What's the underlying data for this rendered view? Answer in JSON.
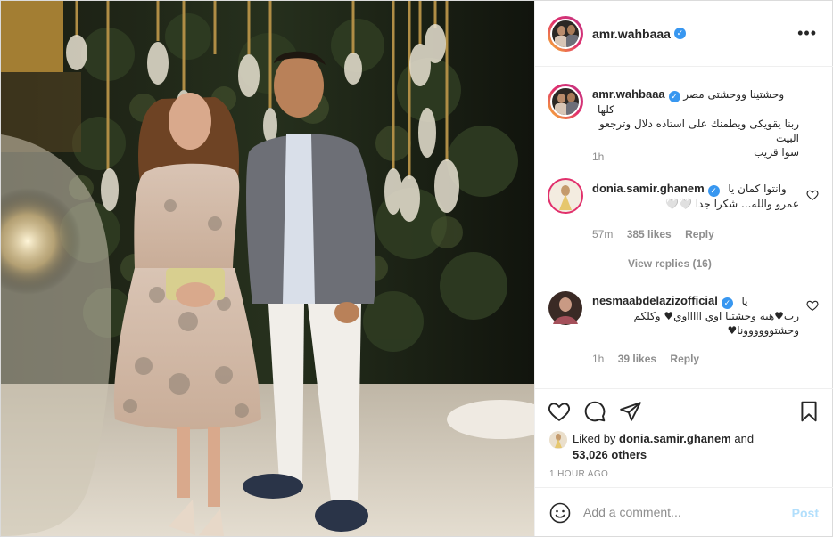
{
  "post": {
    "username": "amr.wahbaaa",
    "verified_mark": "✓",
    "more_icon": "more-horizontal-icon"
  },
  "caption": {
    "username": "amr.wahbaaa",
    "lines": [
      "وحشتينا ووحشتى مصر كلها",
      "ربنا يقويكى ويطمنك على استاذه دلال وترجعو البيت",
      "سوا قريب"
    ],
    "time": "1h"
  },
  "comments": [
    {
      "username": "donia.samir.ghanem",
      "lines": [
        "وانتوا كمان يا",
        "عمرو والله... شكرا جدا 🤍🤍"
      ],
      "time": "57m",
      "likes": "385 likes",
      "reply": "Reply",
      "view_replies": "View replies (16)"
    },
    {
      "username": "nesmaabdelazizofficial",
      "lines": [
        "يا",
        "رب♥هيه وحشتنا اوي اااااوي♥ وكلكم",
        "وحشتوووووونا♥"
      ],
      "time": "1h",
      "likes": "39 likes",
      "reply": "Reply"
    }
  ],
  "actions": {
    "like_icon": "heart-icon",
    "comment_icon": "comment-icon",
    "share_icon": "share-icon",
    "save_icon": "bookmark-icon"
  },
  "likes": {
    "prefix": "Liked by",
    "user": "donia.samir.ghanem",
    "and": "and",
    "others": "53,026 others"
  },
  "timestamp": "1 HOUR AGO",
  "add_comment": {
    "placeholder": "Add a comment...",
    "post_label": "Post"
  },
  "colors": {
    "verified": "#3897f0",
    "post_button": "#b2dffc",
    "muted": "#8e8e8e"
  }
}
